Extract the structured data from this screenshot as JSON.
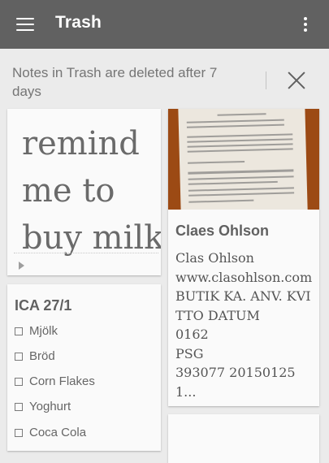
{
  "appbar": {
    "title": "Trash",
    "menu_icon": "hamburger-menu-icon",
    "more_icon": "more-vert-icon"
  },
  "notice": {
    "text": "Notes in Trash are deleted after 7 days",
    "close_icon": "close-icon"
  },
  "notes": {
    "reminder": {
      "text": "remind me to buy milk",
      "icon": "play-arrow-icon"
    },
    "checklist": {
      "title": "ICA 27/1",
      "items": [
        "Mjölk",
        "Bröd",
        "Corn Flakes",
        "Yoghurt",
        "Coca Cola"
      ]
    },
    "receipt": {
      "title": "Claes Ohlson",
      "body": [
        "Clas Ohlson",
        "www.clasohlson.com",
        "BUTIK KA. ANV. KVITTO DATUM",
        "0162",
        "PSG",
        "393077 20150125 1..."
      ]
    }
  },
  "colors": {
    "appbar": "#616161",
    "background": "#ebebeb",
    "card": "#fafafa"
  }
}
